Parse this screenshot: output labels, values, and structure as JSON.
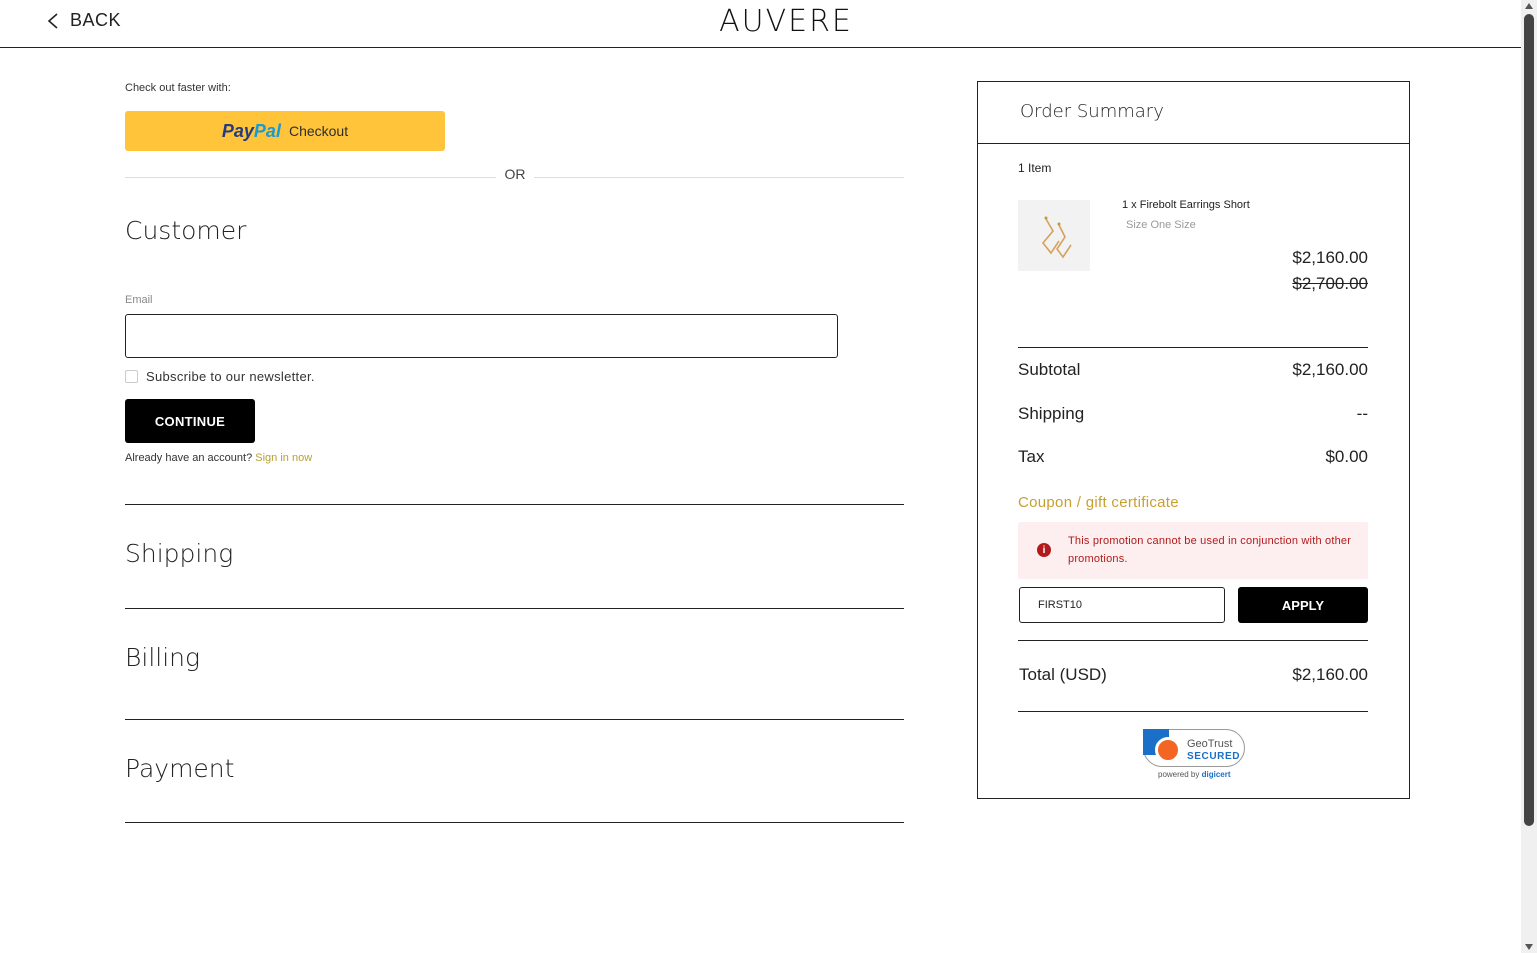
{
  "header": {
    "back_label": "BACK",
    "brand": "AUVERE"
  },
  "express": {
    "prompt": "Check out faster with:",
    "paypal_word1": "Pay",
    "paypal_word2": "Pal",
    "paypal_checkout": "Checkout",
    "divider_text": "OR"
  },
  "customer": {
    "title": "Customer",
    "email_label": "Email",
    "email_value": "",
    "newsletter_label": "Subscribe to our newsletter.",
    "continue_label": "CONTINUE",
    "account_prompt": "Already have an account?",
    "sign_in_link": "Sign in now"
  },
  "sections": {
    "shipping": "Shipping",
    "billing": "Billing",
    "payment": "Payment"
  },
  "summary": {
    "title": "Order Summary",
    "item_count": "1 Item",
    "product": {
      "name": "1 x Firebolt Earrings Short",
      "size": "Size One Size",
      "price": "$2,160.00",
      "original_price": "$2,700.00"
    },
    "subtotal_label": "Subtotal",
    "subtotal_value": "$2,160.00",
    "shipping_label": "Shipping",
    "shipping_value": "--",
    "tax_label": "Tax",
    "tax_value": "$0.00",
    "coupon_link": "Coupon / gift certificate",
    "alert_message": "This promotion cannot be used in conjunction with other promotions.",
    "coupon_value": "FIRST10",
    "apply_label": "APPLY",
    "total_label": "Total (USD)",
    "total_value": "$2,160.00"
  },
  "seal": {
    "name": "GeoTrust",
    "secured": "SECURED",
    "powered_by": "powered by",
    "brand": "digicert"
  },
  "colors": {
    "accent_gold": "#c8a030",
    "paypal_yellow": "#ffc439",
    "alert_red": "#b31b1b",
    "alert_bg": "#fdeef0"
  }
}
